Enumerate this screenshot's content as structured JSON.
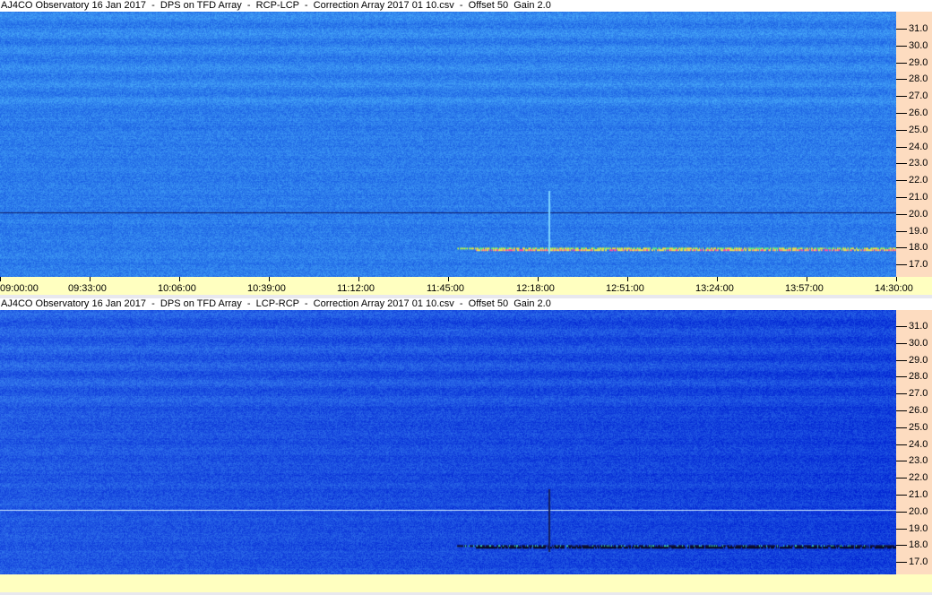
{
  "panels": [
    {
      "title": "AJ4CO Observatory 16 Jan 2017  -  DPS on TFD Array  -  RCP-LCP  -  Correction Array 2017 01 10.csv  -  Offset 50  Gain 2.0",
      "base_color": "#2a78ea",
      "marker_line_color": "#10206a"
    },
    {
      "title": "AJ4CO Observatory 16 Jan 2017  -  DPS on TFD Array  -  LCP-RCP  -  Correction Array 2017 01 10.csv  -  Offset 50  Gain 2.0",
      "base_color": "#1f56e2",
      "marker_line_color": "#cfe8ff"
    }
  ],
  "frequency_ticks": [
    "31.0",
    "30.0",
    "29.0",
    "28.0",
    "27.0",
    "26.0",
    "25.0",
    "24.0",
    "23.0",
    "22.0",
    "21.0",
    "20.0",
    "19.0",
    "18.0",
    "17.0"
  ],
  "time_ticks": [
    "09:00:00",
    "09:33:00",
    "10:06:00",
    "10:39:00",
    "11:12:00",
    "11:45:00",
    "12:18:00",
    "12:51:00",
    "13:24:00",
    "13:57:00",
    "14:30:00"
  ],
  "colors": {
    "freq_axis_bg": "#fddcc0",
    "time_axis_bg": "#ffffc0"
  }
}
